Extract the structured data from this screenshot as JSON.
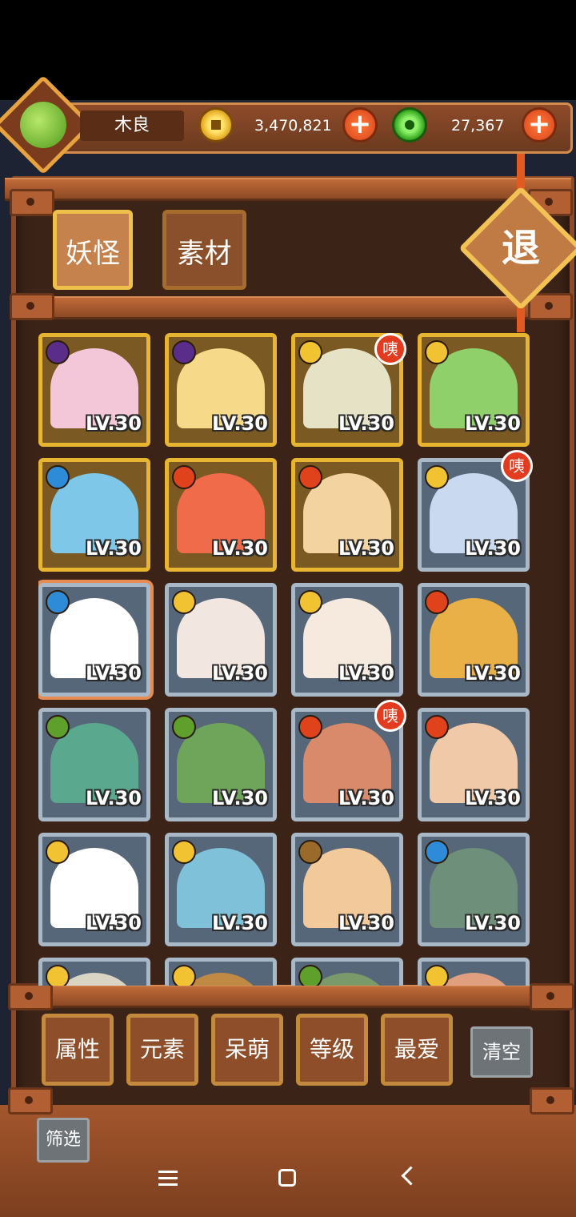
{
  "header": {
    "player_name": "木良",
    "gold_amount": "3,470,821",
    "jade_amount": "27,367",
    "add_symbol": "+"
  },
  "tabs": [
    {
      "label": "妖怪",
      "active": true
    },
    {
      "label": "素材",
      "active": false
    }
  ],
  "exit_label": "退",
  "cards": [
    {
      "element": "moon-icon",
      "frame": "gold",
      "level": "LV.30"
    },
    {
      "element": "moon-icon",
      "frame": "gold",
      "level": "LV.30"
    },
    {
      "element": "sun-icon",
      "frame": "gold",
      "level": "LV.30",
      "badge": "咦"
    },
    {
      "element": "sun-icon",
      "frame": "gold",
      "level": "LV.30"
    },
    {
      "element": "water-icon",
      "frame": "gold",
      "level": "LV.30"
    },
    {
      "element": "fire-icon",
      "frame": "gold",
      "level": "LV.30"
    },
    {
      "element": "fire-icon",
      "frame": "gold",
      "level": "LV.30"
    },
    {
      "element": "sun-icon",
      "frame": "silver",
      "level": "LV.30",
      "badge": "咦"
    },
    {
      "element": "water-icon",
      "frame": "silver",
      "level": "LV.30",
      "selected": true
    },
    {
      "element": "sun-icon",
      "frame": "silver",
      "level": "LV.30"
    },
    {
      "element": "sun-icon",
      "frame": "silver",
      "level": "LV.30"
    },
    {
      "element": "fire-icon",
      "frame": "silver",
      "level": "LV.30"
    },
    {
      "element": "leaf-icon",
      "frame": "silver",
      "level": "LV.30"
    },
    {
      "element": "leaf-icon",
      "frame": "silver",
      "level": "LV.30"
    },
    {
      "element": "fire-icon",
      "frame": "silver",
      "level": "LV.30",
      "badge": "咦"
    },
    {
      "element": "fire-icon",
      "frame": "silver",
      "level": "LV.30"
    },
    {
      "element": "sun-icon",
      "frame": "silver",
      "level": "LV.30"
    },
    {
      "element": "sun-icon",
      "frame": "silver",
      "level": "LV.30"
    },
    {
      "element": "earth-icon",
      "frame": "silver",
      "level": "LV.30"
    },
    {
      "element": "water-icon",
      "frame": "silver",
      "level": "LV.30"
    },
    {
      "element": "sun-icon",
      "frame": "silver",
      "level": ""
    },
    {
      "element": "sun-icon",
      "frame": "silver",
      "level": ""
    },
    {
      "element": "leaf-icon",
      "frame": "silver",
      "level": ""
    },
    {
      "element": "sun-icon",
      "frame": "silver",
      "level": ""
    }
  ],
  "filters": [
    "属性",
    "元素",
    "呆萌",
    "等级",
    "最爱"
  ],
  "clear_label": "清空",
  "sift_label": "筛选",
  "colors": {
    "gold_frame": "#e8b530",
    "silver_frame": "#a9b8c6",
    "wood": "#8b4a28",
    "badge": "#e23b1f"
  }
}
